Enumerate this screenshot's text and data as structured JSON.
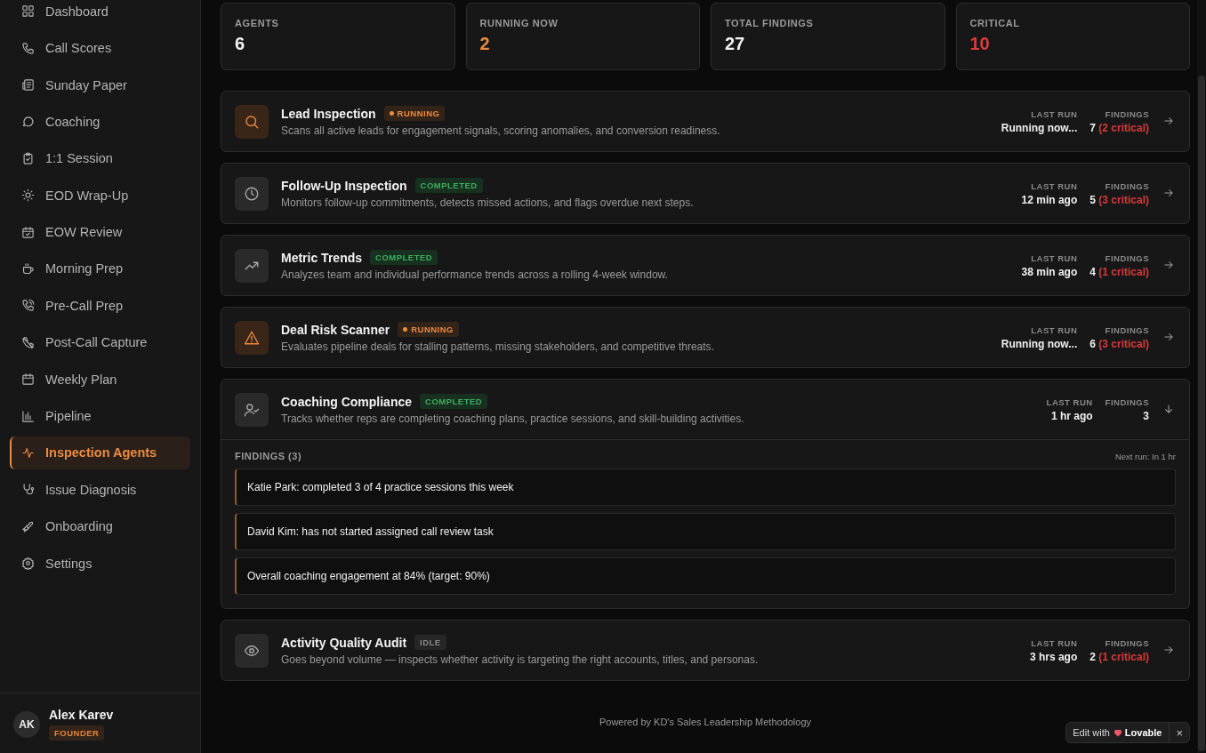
{
  "sidebar": {
    "items": [
      {
        "label": "Dashboard",
        "selected": false
      },
      {
        "label": "Call Scores",
        "selected": false
      },
      {
        "label": "Sunday Paper",
        "selected": false
      },
      {
        "label": "Coaching",
        "selected": false
      },
      {
        "label": "1:1 Session",
        "selected": false
      },
      {
        "label": "EOD Wrap-Up",
        "selected": false
      },
      {
        "label": "EOW Review",
        "selected": false
      },
      {
        "label": "Morning Prep",
        "selected": false
      },
      {
        "label": "Pre-Call Prep",
        "selected": false
      },
      {
        "label": "Post-Call Capture",
        "selected": false
      },
      {
        "label": "Weekly Plan",
        "selected": false
      },
      {
        "label": "Pipeline",
        "selected": false
      },
      {
        "label": "Inspection Agents",
        "selected": true
      },
      {
        "label": "Issue Diagnosis",
        "selected": false
      },
      {
        "label": "Onboarding",
        "selected": false
      },
      {
        "label": "Settings",
        "selected": false
      }
    ],
    "user": {
      "initials": "AK",
      "name": "Alex Karev",
      "role": "FOUNDER"
    }
  },
  "stats": [
    {
      "label": "AGENTS",
      "value": "6",
      "kind": "plain"
    },
    {
      "label": "RUNNING NOW",
      "value": "2",
      "kind": "running"
    },
    {
      "label": "TOTAL FINDINGS",
      "value": "27",
      "kind": "plain"
    },
    {
      "label": "CRITICAL",
      "value": "10",
      "kind": "critical"
    }
  ],
  "agents": [
    {
      "title": "Lead Inspection",
      "status": {
        "label": "RUNNING",
        "kind": "running"
      },
      "description": "Scans all active leads for engagement signals, scoring anomalies, and conversion readiness.",
      "last_run_label": "LAST RUN",
      "last_run": "Running now...",
      "findings_label": "FINDINGS",
      "findings_count": "7",
      "findings_critical": "(2 critical)",
      "expanded": false
    },
    {
      "title": "Follow-Up Inspection",
      "status": {
        "label": "COMPLETED",
        "kind": "completed"
      },
      "description": "Monitors follow-up commitments, detects missed actions, and flags overdue next steps.",
      "last_run_label": "LAST RUN",
      "last_run": "12 min ago",
      "findings_label": "FINDINGS",
      "findings_count": "5",
      "findings_critical": "(3 critical)",
      "expanded": false
    },
    {
      "title": "Metric Trends",
      "status": {
        "label": "COMPLETED",
        "kind": "completed"
      },
      "description": "Analyzes team and individual performance trends across a rolling 4-week window.",
      "last_run_label": "LAST RUN",
      "last_run": "38 min ago",
      "findings_label": "FINDINGS",
      "findings_count": "4",
      "findings_critical": "(1 critical)",
      "expanded": false
    },
    {
      "title": "Deal Risk Scanner",
      "status": {
        "label": "RUNNING",
        "kind": "running"
      },
      "description": "Evaluates pipeline deals for stalling patterns, missing stakeholders, and competitive threats.",
      "last_run_label": "LAST RUN",
      "last_run": "Running now...",
      "findings_label": "FINDINGS",
      "findings_count": "6",
      "findings_critical": "(3 critical)",
      "expanded": false
    },
    {
      "title": "Coaching Compliance",
      "status": {
        "label": "COMPLETED",
        "kind": "completed"
      },
      "description": "Tracks whether reps are completing coaching plans, practice sessions, and skill-building activities.",
      "last_run_label": "LAST RUN",
      "last_run": "1 hr ago",
      "findings_label": "FINDINGS",
      "findings_count": "3",
      "expanded": true,
      "details": {
        "heading": "FINDINGS (3)",
        "next_run": "Next run: In 1 hr",
        "items": [
          "Katie Park: completed 3 of 4 practice sessions this week",
          "David Kim: has not started assigned call review task",
          "Overall coaching engagement at 84% (target: 90%)"
        ]
      }
    },
    {
      "title": "Activity Quality Audit",
      "status": {
        "label": "IDLE",
        "kind": "idle"
      },
      "description": "Goes beyond volume — inspects whether activity is targeting the right accounts, titles, and personas.",
      "last_run_label": "LAST RUN",
      "last_run": "3 hrs ago",
      "findings_label": "FINDINGS",
      "findings_count": "2",
      "findings_critical": "(1 critical)",
      "expanded": false
    }
  ],
  "footer": "Powered by KD's Sales Leadership Methodology",
  "badge": {
    "prefix": "Edit with",
    "brand": "Lovable",
    "close": "×"
  }
}
